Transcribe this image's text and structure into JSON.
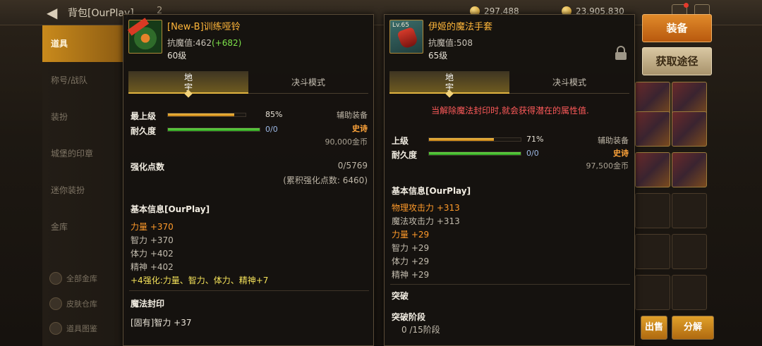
{
  "topbar": {
    "title": "背包[OurPlay]",
    "count": "2",
    "currency1": "297,488",
    "currency2": "23,905,830"
  },
  "sidebar": {
    "items": [
      {
        "label": "道具",
        "active": true
      },
      {
        "label": "称号/战队",
        "active": false
      },
      {
        "label": "装扮",
        "active": false
      },
      {
        "label": "城堡的印章",
        "active": false
      },
      {
        "label": "迷你装扮",
        "active": false
      },
      {
        "label": "金库",
        "active": false
      }
    ],
    "small_items": [
      "全部金库",
      "皮肤仓库",
      "道具图鉴"
    ]
  },
  "actions": {
    "equip": "装备",
    "get_source": "获取途径",
    "sell": "出售",
    "decompose": "分解"
  },
  "left_item": {
    "icon": "bell-dumbbell-item-icon",
    "name": "[New-B]训练哑铃",
    "resist_label": "抗魔值:462",
    "resist_bonus": "(+682)",
    "level": "60级",
    "tabs": [
      "地宇",
      "决斗模式"
    ],
    "active_tab_line1": "地",
    "active_tab_line2": "宇",
    "stats": [
      {
        "label": "最上级",
        "value": "85%",
        "fill": 0.85,
        "color": "orange"
      },
      {
        "label": "耐久度",
        "value": "0/0",
        "fill": 1.0,
        "color": "green"
      }
    ],
    "type": "辅助装备",
    "rarity": "史诗",
    "price": "90,000金币",
    "enhance_label": "强化点数",
    "enhance_value": "0/5769",
    "enhance_total": "(累积强化点数: 6460)",
    "basic_info_title": "基本信息[OurPlay]",
    "attributes": [
      {
        "text": "力量 +370",
        "style": "orange"
      },
      {
        "text": "智力 +370",
        "style": "gray"
      },
      {
        "text": "体力 +402",
        "style": "gray"
      },
      {
        "text": "精神 +402",
        "style": "gray"
      },
      {
        "text": "+4强化:力量、智力、体力、精神+7",
        "style": "yellow"
      }
    ],
    "magic_seal_title": "魔法封印",
    "magic_seal_attr": "[固有]智力 +37"
  },
  "right_item": {
    "icon": "magic-glove-item-icon",
    "icon_level": "Lv.65",
    "name": "伊姬的魔法手套",
    "resist_label": "抗魔值:508",
    "level": "65级",
    "locked": true,
    "tabs": [
      "地宇",
      "决斗模式"
    ],
    "active_tab_line1": "地",
    "active_tab_line2": "宇",
    "warning": "当解除魔法封印时,就会获得潜在的属性值.",
    "stats": [
      {
        "label": "上级",
        "value": "71%",
        "fill": 0.71,
        "color": "orange"
      },
      {
        "label": "耐久度",
        "value": "0/0",
        "fill": 1.0,
        "color": "green"
      }
    ],
    "type": "辅助装备",
    "rarity": "史诗",
    "price": "97,500金币",
    "basic_info_title": "基本信息[OurPlay]",
    "attributes": [
      {
        "text": "物理攻击力 +313",
        "style": "orange"
      },
      {
        "text": "魔法攻击力 +313",
        "style": "gray"
      },
      {
        "text": "力量 +29",
        "style": "orange"
      },
      {
        "text": "智力 +29",
        "style": "gray"
      },
      {
        "text": "体力 +29",
        "style": "gray"
      },
      {
        "text": "精神 +29",
        "style": "gray"
      }
    ],
    "breakthrough_title": "突破",
    "breakthrough_stage_label": "突破阶段",
    "breakthrough_stage_value": "0 /15阶段"
  },
  "colors": {
    "accent_orange": "#ffb63a",
    "bonus_green": "#7de24a",
    "warning_red": "#ff5a5a",
    "epic": "#ffa43a"
  }
}
